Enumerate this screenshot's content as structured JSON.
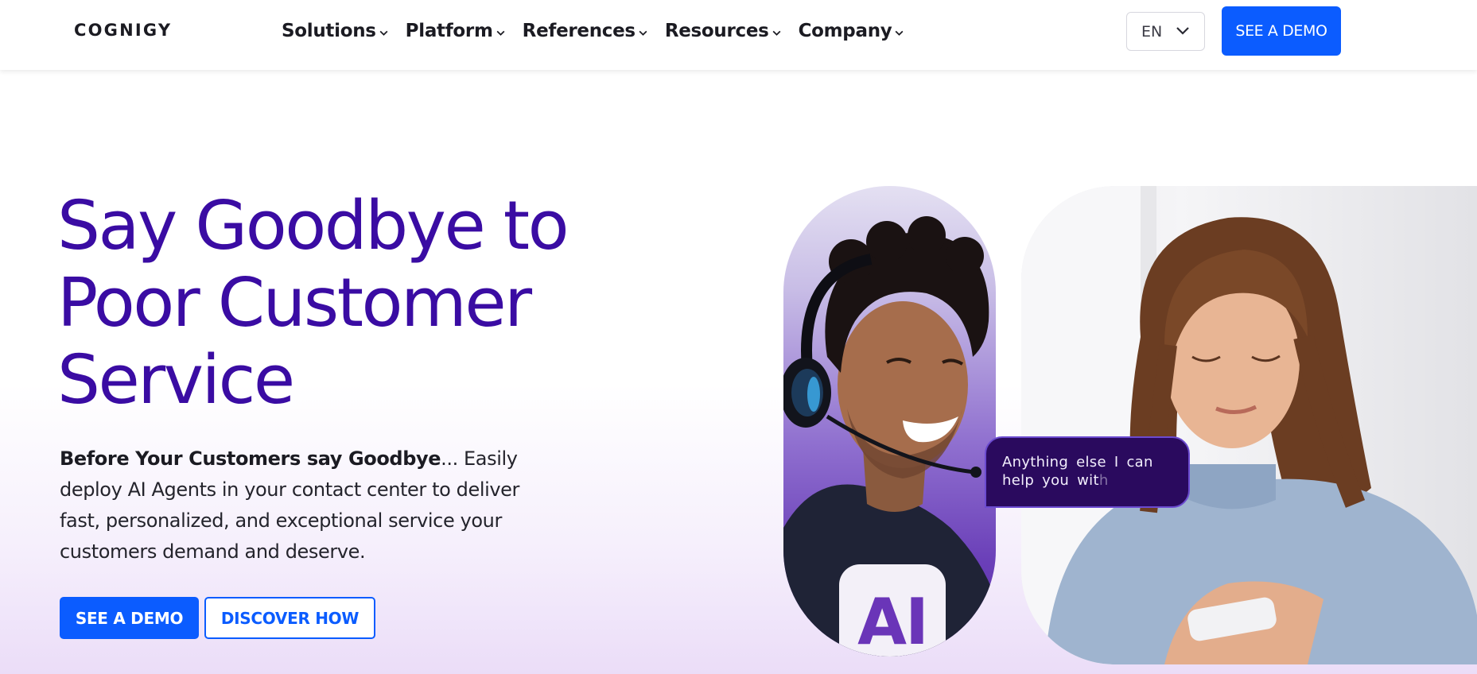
{
  "brand": {
    "logo_text": "COGNIGY"
  },
  "nav": {
    "items": [
      {
        "label": "Solutions"
      },
      {
        "label": "Platform"
      },
      {
        "label": "References"
      },
      {
        "label": "Resources"
      },
      {
        "label": "Company"
      }
    ],
    "language": "EN",
    "demo_button": "SEE A DEMO"
  },
  "hero": {
    "title_lines": [
      "Say Goodbye to",
      "Poor Customer",
      "Service"
    ],
    "desc_bold": "Before Your Customers say Goodbye",
    "desc_rest": "... Easily deploy AI Agents in your contact center to deliver fast, personalized, and exceptional service your customers demand and deserve.",
    "primary_button": "SEE A DEMO",
    "secondary_button": "DISCOVER HOW"
  },
  "imagery": {
    "ai_badge": "AI",
    "headset_badge": "AI",
    "chat_bubble": "Anything else I can help you wit",
    "chat_bubble_fade": "h"
  },
  "colors": {
    "accent_blue": "#0b5cff",
    "title_purple": "#3a0ca3",
    "bubble_bg": "#2a0a5e"
  }
}
